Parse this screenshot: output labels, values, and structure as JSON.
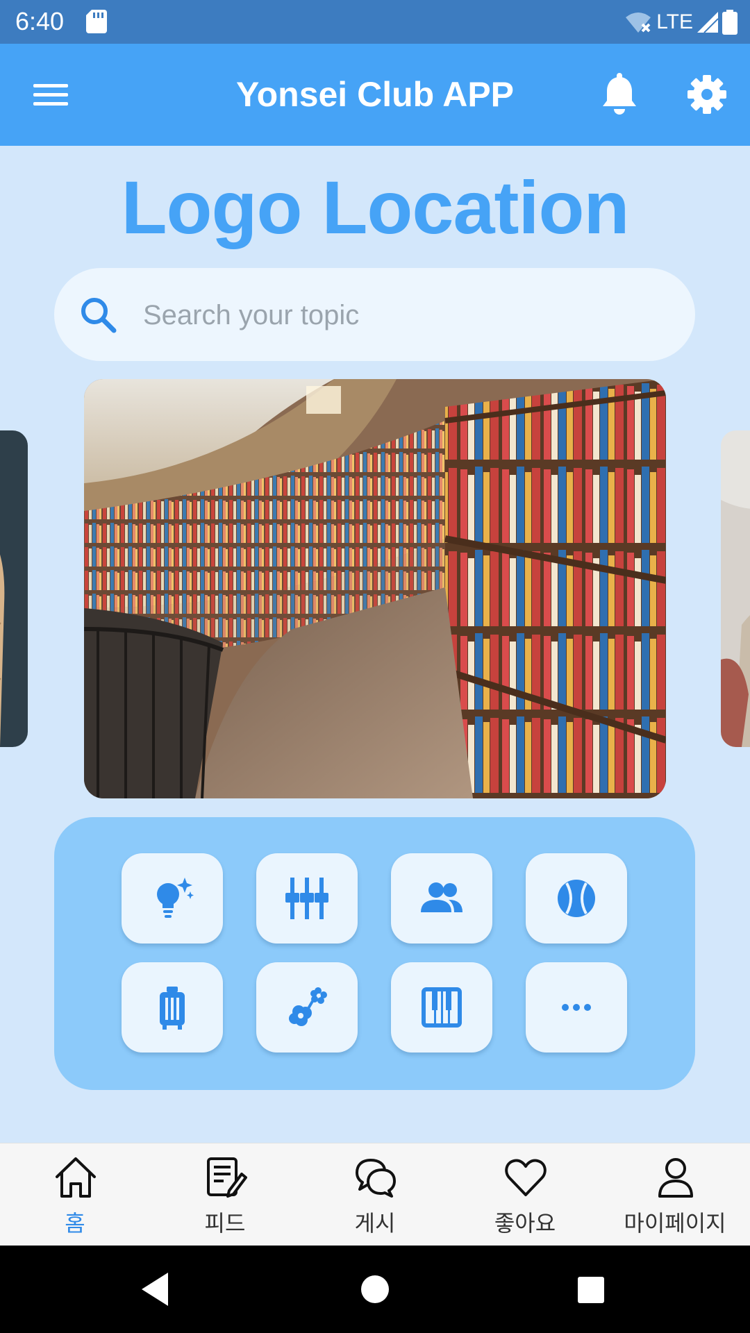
{
  "status_bar": {
    "time": "6:40",
    "network": "LTE",
    "icons": [
      "sd-card-icon",
      "wifi-off-icon",
      "signal-icon",
      "battery-icon"
    ]
  },
  "app_bar": {
    "title": "Yonsei Club APP",
    "icons": [
      "menu-icon",
      "bell-icon",
      "gear-icon"
    ]
  },
  "logo": {
    "text": "Logo Location"
  },
  "search": {
    "placeholder": "Search your topic"
  },
  "carousel": {
    "slides": [
      "library-bookshelf-image",
      "person-sweater-image",
      "person-image"
    ],
    "active_index": 0
  },
  "categories": [
    {
      "icon": "lightbulb-sparkle-icon"
    },
    {
      "icon": "equalizer-icon"
    },
    {
      "icon": "people-icon"
    },
    {
      "icon": "baseball-icon"
    },
    {
      "icon": "luggage-icon"
    },
    {
      "icon": "flower-icon"
    },
    {
      "icon": "piano-icon"
    },
    {
      "icon": "more-icon"
    }
  ],
  "bottom_nav": {
    "items": [
      {
        "label": "홈",
        "icon": "home-icon",
        "active": true
      },
      {
        "label": "피드",
        "icon": "edit-note-icon",
        "active": false
      },
      {
        "label": "게시",
        "icon": "chat-bubbles-icon",
        "active": false
      },
      {
        "label": "좋아요",
        "icon": "heart-icon",
        "active": false
      },
      {
        "label": "마이페이지",
        "icon": "user-icon",
        "active": false
      }
    ]
  },
  "colors": {
    "status_bar": "#3d7cc0",
    "app_bar": "#46a3f6",
    "background": "#d3e7fb",
    "panel": "#8ccafa",
    "accent": "#2f8ae8"
  }
}
